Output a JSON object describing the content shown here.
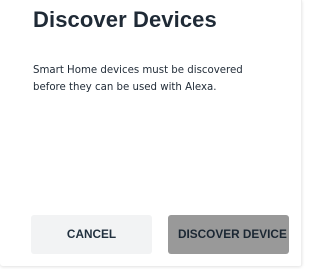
{
  "dialog": {
    "title": "Discover Devices",
    "message": "Smart Home devices must be discovered before they can be used with Alexa.",
    "cancel_label": "CANCEL",
    "discover_label": "DISCOVER DEVICE"
  },
  "colors": {
    "title_text": "#1f2a36",
    "cancel_bg": "#f2f3f4",
    "discover_bg": "#999999"
  }
}
